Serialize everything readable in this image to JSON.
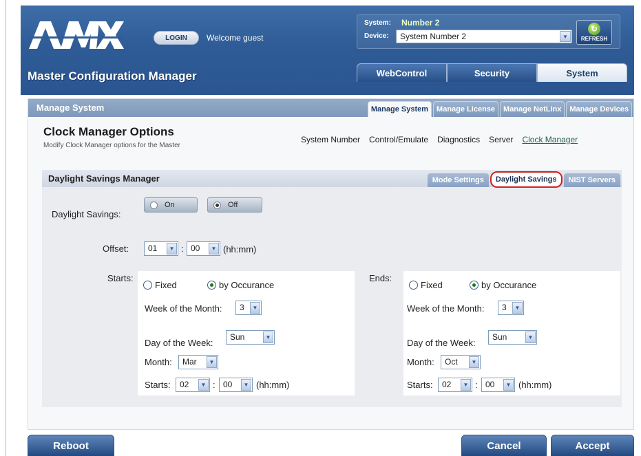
{
  "header": {
    "logo_text": "AMX",
    "login_label": "LOGIN",
    "welcome_text": "Welcome guest",
    "system_label": "System:",
    "system_value": "Number 2",
    "device_label": "Device:",
    "device_value": "System Number 2",
    "refresh_label": "REFRESH",
    "app_title": "Master Configuration Manager",
    "main_tabs": [
      {
        "label": "WebControl",
        "active": false
      },
      {
        "label": "Security",
        "active": false
      },
      {
        "label": "System",
        "active": true
      }
    ]
  },
  "panel": {
    "title": "Manage System",
    "sub_tabs": [
      {
        "label": "Manage System",
        "active": true
      },
      {
        "label": "Manage License",
        "active": false
      },
      {
        "label": "Manage NetLinx",
        "active": false
      },
      {
        "label": "Manage Devices",
        "active": false
      }
    ],
    "page_title": "Clock Manager Options",
    "page_subtitle": "Modify Clock Manager options for the Master",
    "links": [
      {
        "label": "System Number",
        "active": false
      },
      {
        "label": "Control/Emulate",
        "active": false
      },
      {
        "label": "Diagnostics",
        "active": false
      },
      {
        "label": "Server",
        "active": false
      },
      {
        "label": "Clock Manager",
        "active": true
      }
    ]
  },
  "dst": {
    "title": "Daylight Savings Manager",
    "tabs": [
      {
        "label": "Mode Settings",
        "active": false
      },
      {
        "label": "Daylight Savings",
        "active": true
      },
      {
        "label": "NIST Servers",
        "active": false
      }
    ],
    "daylight_label": "Daylight Savings:",
    "on_label": "On",
    "off_label": "Off",
    "selected_mode": "Off",
    "offset_label": "Offset:",
    "offset_hours": "01",
    "offset_minutes": "00",
    "hhmm": "(hh:mm)",
    "colon": ":",
    "starts": {
      "heading": "Starts:",
      "fixed_label": "Fixed",
      "occurance_label": "by Occurance",
      "selected": "by Occurance",
      "week_label": "Week of the Month:",
      "week_value": "3",
      "day_label": "Day of the Week:",
      "day_value": "Sun",
      "month_label": "Month:",
      "month_value": "Mar",
      "time_label": "Starts:",
      "hour_value": "02",
      "minute_value": "00"
    },
    "ends": {
      "heading": "Ends:",
      "fixed_label": "Fixed",
      "occurance_label": "by Occurance",
      "selected": "by Occurance",
      "week_label": "Week of the Month:",
      "week_value": "3",
      "day_label": "Day of the Week:",
      "day_value": "Sun",
      "month_label": "Month:",
      "month_value": "Oct",
      "time_label": "Starts:",
      "hour_value": "02",
      "minute_value": "00"
    }
  },
  "footer": {
    "reboot_label": "Reboot",
    "cancel_label": "Cancel",
    "accept_label": "Accept"
  },
  "colors": {
    "header_blue": "#2f5c96",
    "highlight_red": "#d41f1f",
    "active_link_green": "#23604a"
  }
}
